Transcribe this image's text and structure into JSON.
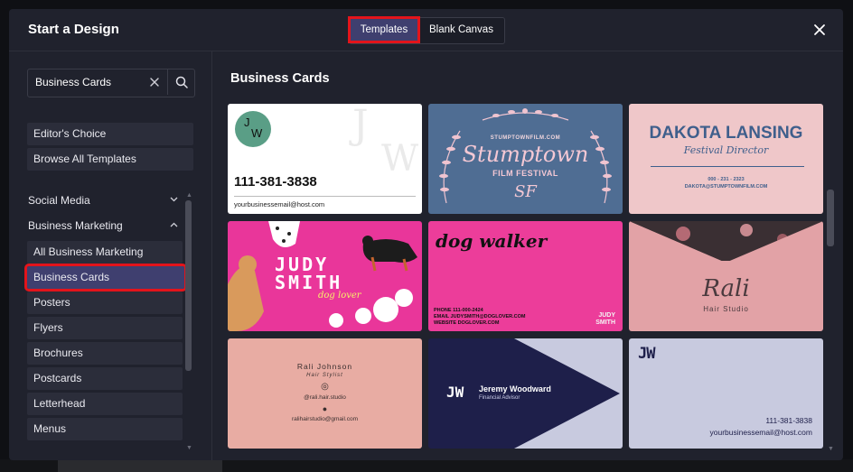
{
  "modal": {
    "title": "Start a Design"
  },
  "tabs": [
    {
      "label": "Templates",
      "active": true
    },
    {
      "label": "Blank Canvas",
      "active": false
    }
  ],
  "close_icon": "close-icon",
  "search": {
    "value": "Business Cards",
    "clear_icon": "clear-icon",
    "search_icon": "search-icon"
  },
  "sidebar": {
    "top_items": [
      {
        "label": "Editor's Choice"
      },
      {
        "label": "Browse All Templates"
      }
    ],
    "sections": [
      {
        "label": "Social Media",
        "expanded": false
      },
      {
        "label": "Business Marketing",
        "expanded": true
      }
    ],
    "sub_items": [
      {
        "label": "All Business Marketing"
      },
      {
        "label": "Business Cards",
        "selected": true
      },
      {
        "label": "Posters"
      },
      {
        "label": "Flyers"
      },
      {
        "label": "Brochures"
      },
      {
        "label": "Postcards"
      },
      {
        "label": "Letterhead"
      },
      {
        "label": "Menus"
      }
    ]
  },
  "content": {
    "title": "Business Cards",
    "cards": [
      {
        "id": "jw-white",
        "initials_j": "J",
        "initials_w": "W",
        "watermark": "J",
        "watermark2": "W",
        "phone": "111-381-3838",
        "email": "yourbusinessemail@host.com"
      },
      {
        "id": "stumptown",
        "small": "STUMPTOWNFILM.COM",
        "big": "Stumptown",
        "sub": "FILM FESTIVAL",
        "mark": "SF"
      },
      {
        "id": "dakota",
        "name": "DAKOTA LANSING",
        "role": "Festival Director",
        "line1": "000 - 231 - 2323",
        "line2": "DAKOTA@STUMPTOWNFILM.COM"
      },
      {
        "id": "judy",
        "name1": "JUDY",
        "name2": "SMITH",
        "tag": "dog lover"
      },
      {
        "id": "dogwalker",
        "title": "dog walker",
        "phone": "PHONE  111-000-2424",
        "email": "EMAIL  JUDYSMITH@DOGLOVER.COM",
        "website": "WEBSITE  DOGLOVER.COM",
        "name1": "JUDY",
        "name2": "SMITH"
      },
      {
        "id": "rali-studio",
        "name": "Rali",
        "sub": "Hair Studio"
      },
      {
        "id": "rali-johnson",
        "name": "Rali Johnson",
        "role": "Hair Stylist",
        "handle": "@rali.hair.studio",
        "email": "ralihairstudio@gmail.com"
      },
      {
        "id": "jeremy",
        "logo": "JW",
        "name": "Jeremy Woodward",
        "role": "Financial Advisor"
      },
      {
        "id": "jw-lavender",
        "logo": "JW",
        "phone": "111-381-3838",
        "email": "yourbusinessemail@host.com"
      }
    ]
  },
  "colors": {
    "modal_bg": "#20222d",
    "accent": "#3f3f6f",
    "highlight": "#e3141b"
  }
}
